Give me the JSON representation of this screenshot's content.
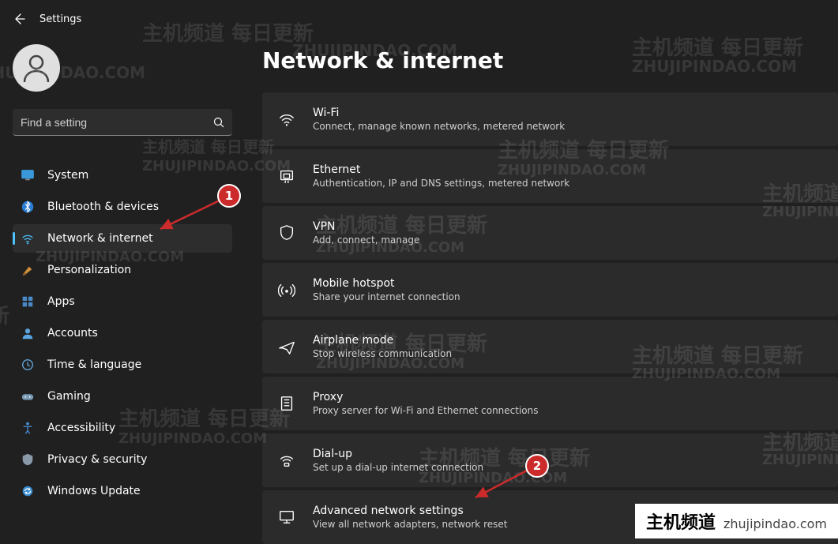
{
  "header": {
    "title": "Settings"
  },
  "sidebar": {
    "search_placeholder": "Find a setting",
    "items": [
      {
        "label": "System",
        "icon": "monitor"
      },
      {
        "label": "Bluetooth & devices",
        "icon": "bluetooth"
      },
      {
        "label": "Network & internet",
        "icon": "wifi",
        "active": true
      },
      {
        "label": "Personalization",
        "icon": "brush"
      },
      {
        "label": "Apps",
        "icon": "apps"
      },
      {
        "label": "Accounts",
        "icon": "person"
      },
      {
        "label": "Time & language",
        "icon": "clock"
      },
      {
        "label": "Gaming",
        "icon": "gamepad"
      },
      {
        "label": "Accessibility",
        "icon": "accessibility"
      },
      {
        "label": "Privacy & security",
        "icon": "shield"
      },
      {
        "label": "Windows Update",
        "icon": "update"
      }
    ]
  },
  "main": {
    "title": "Network & internet",
    "items": [
      {
        "title": "Wi-Fi",
        "sub": "Connect, manage known networks, metered network",
        "icon": "wifi"
      },
      {
        "title": "Ethernet",
        "sub": "Authentication, IP and DNS settings, metered network",
        "icon": "ethernet"
      },
      {
        "title": "VPN",
        "sub": "Add, connect, manage",
        "icon": "shield"
      },
      {
        "title": "Mobile hotspot",
        "sub": "Share your internet connection",
        "icon": "hotspot"
      },
      {
        "title": "Airplane mode",
        "sub": "Stop wireless communication",
        "icon": "airplane"
      },
      {
        "title": "Proxy",
        "sub": "Proxy server for Wi-Fi and Ethernet connections",
        "icon": "proxy"
      },
      {
        "title": "Dial-up",
        "sub": "Set up a dial-up internet connection",
        "icon": "dialup"
      },
      {
        "title": "Advanced network settings",
        "sub": "View all network adapters, network reset",
        "icon": "advanced"
      }
    ]
  },
  "annotations": {
    "a1": "1",
    "a2": "2"
  },
  "watermark": {
    "chinese": "主机频道 每日更新",
    "latin": "ZHUJIPINDAO.COM",
    "corner_big": "主机频道",
    "corner_small": "zhujipindao.com"
  }
}
